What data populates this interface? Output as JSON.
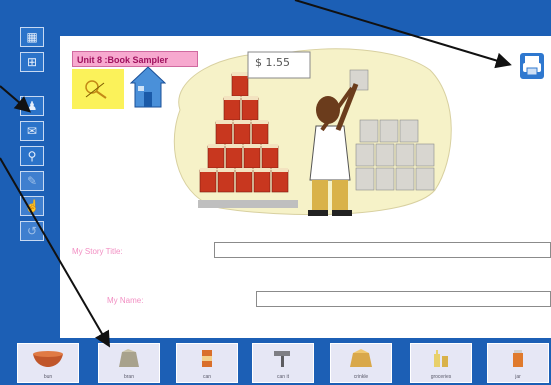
{
  "worksheet": {
    "title": "Unit 8 :Book Sampler",
    "scene_sign": "$ 1.55",
    "story_title_label": "My Story Title:",
    "story_title_value": "",
    "name_label": "My Name:",
    "name_value": ""
  },
  "left_toolbar": {
    "icons": [
      "grid-icon",
      "grid-icon",
      "person-icon",
      "envelope-icon",
      "search-icon",
      "pencil-icon",
      "hand-icon",
      "undo-icon"
    ]
  },
  "word_buttons": [
    {
      "label": "bun",
      "icon": "bowl-icon"
    },
    {
      "label": "bran",
      "icon": "bag-icon"
    },
    {
      "label": "can",
      "icon": "can-icon"
    },
    {
      "label": "can it",
      "icon": "hammer-icon"
    },
    {
      "label": "crinkle",
      "icon": "bag-icon"
    },
    {
      "label": "groceries",
      "icon": "bottles-icon"
    },
    {
      "label": "jar",
      "icon": "jar-icon"
    }
  ],
  "colors": {
    "frame_blue": "#1c5fb5",
    "title_pink": "#f7a9cf",
    "label_pink": "#f28fc3",
    "note_yellow": "#fbf25a",
    "button_face": "#e6e7f5"
  }
}
